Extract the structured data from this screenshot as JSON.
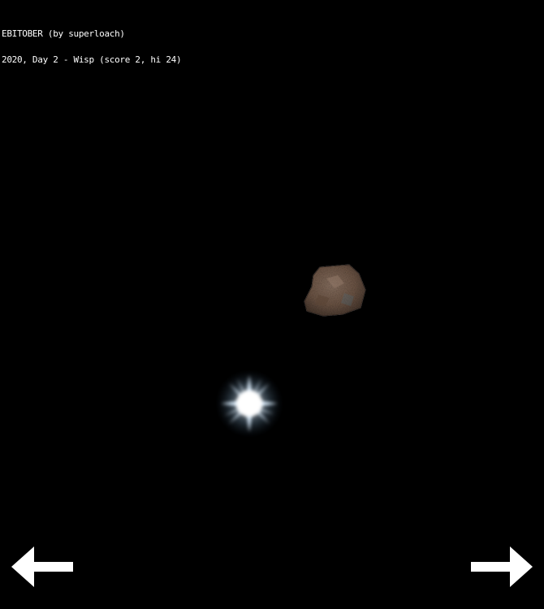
{
  "hud": {
    "title": "EBITOBER (by superloach)",
    "status": "2020, Day 2 - Wisp (score 2, hi 24)"
  },
  "game": {
    "background": "#000000",
    "rock_icon": "rock-icon",
    "wisp_icon": "wisp-icon",
    "wisp_color": "#cfe6ff",
    "rock_color": "#7a5f4d"
  },
  "controls": {
    "left_icon": "arrow-left-icon",
    "right_icon": "arrow-right-icon"
  }
}
